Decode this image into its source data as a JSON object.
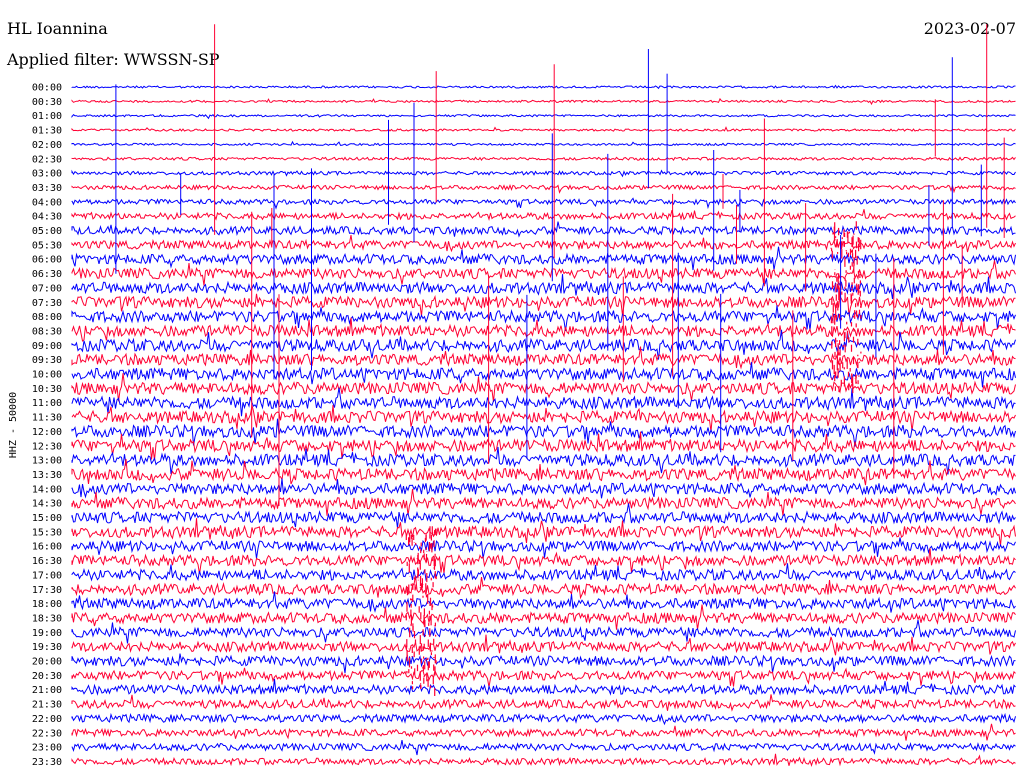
{
  "header": {
    "station": "HL Ioannina",
    "date": "2023-02-07",
    "filter_label": "Applied filter: WWSSN-SP"
  },
  "chart_data": {
    "type": "line",
    "title": "HL Ioannina",
    "subtitle": "Applied filter: WWSSN-SP",
    "ylabel": "HHZ - 50000",
    "date": "2023-02-07",
    "trace_colors": [
      "#0000ff",
      "#ff0033"
    ],
    "row_labels": [
      "00:00",
      "00:30",
      "01:00",
      "01:30",
      "02:00",
      "02:30",
      "03:00",
      "03:30",
      "04:00",
      "04:30",
      "05:00",
      "05:30",
      "06:00",
      "06:30",
      "07:00",
      "07:30",
      "08:00",
      "08:30",
      "09:00",
      "09:30",
      "10:00",
      "10:30",
      "11:00",
      "11:30",
      "12:00",
      "12:30",
      "13:00",
      "13:30",
      "14:00",
      "14:30",
      "15:00",
      "15:30",
      "16:00",
      "16:30",
      "17:00",
      "17:30",
      "18:00",
      "18:30",
      "19:00",
      "19:30",
      "20:00",
      "20:30",
      "21:00",
      "21:30",
      "22:00",
      "22:30",
      "23:00",
      "23:30"
    ],
    "row_labels_display": [
      "00:00",
      "00:30",
      "01:00",
      "01:30",
      "02:00",
      "02:30",
      "03:00",
      "03:30",
      "04:00",
      "04:30",
      "05:00",
      "05:30",
      "06:00",
      "06:30",
      "07:00",
      "07:30",
      "08:00",
      "08:30",
      "09:00",
      "09:30",
      "10:00",
      "10:30",
      "11:00",
      "11:30",
      "12:00",
      "12:30",
      "13:00",
      "13:30",
      "14:00",
      "14:30",
      "15:00",
      "15:30",
      "16:00",
      "16:30",
      "17:00",
      "17:30",
      "18:00",
      "18:30",
      "19:00",
      "19:30",
      "20:00",
      "20:30",
      "21:00",
      "21:30",
      "22:00",
      "22:30",
      "23:00",
      "23:30"
    ],
    "noise_level": [
      0.15,
      0.15,
      0.15,
      0.15,
      0.15,
      0.2,
      0.25,
      0.3,
      0.35,
      0.45,
      0.55,
      0.6,
      0.7,
      0.75,
      0.8,
      0.8,
      0.8,
      0.8,
      0.85,
      0.8,
      0.85,
      0.85,
      0.85,
      0.85,
      0.85,
      0.85,
      0.85,
      0.85,
      0.8,
      0.8,
      0.8,
      0.8,
      0.75,
      0.75,
      0.75,
      0.75,
      0.75,
      0.75,
      0.7,
      0.7,
      0.7,
      0.65,
      0.65,
      0.6,
      0.55,
      0.5,
      0.5,
      0.45
    ],
    "events": [
      {
        "row": 16,
        "x_fraction": 0.82,
        "amplitude": "large",
        "color": "#ff0033"
      },
      {
        "row": 37,
        "x_fraction": 0.37,
        "amplitude": "large",
        "color": "#ff0033"
      }
    ]
  }
}
